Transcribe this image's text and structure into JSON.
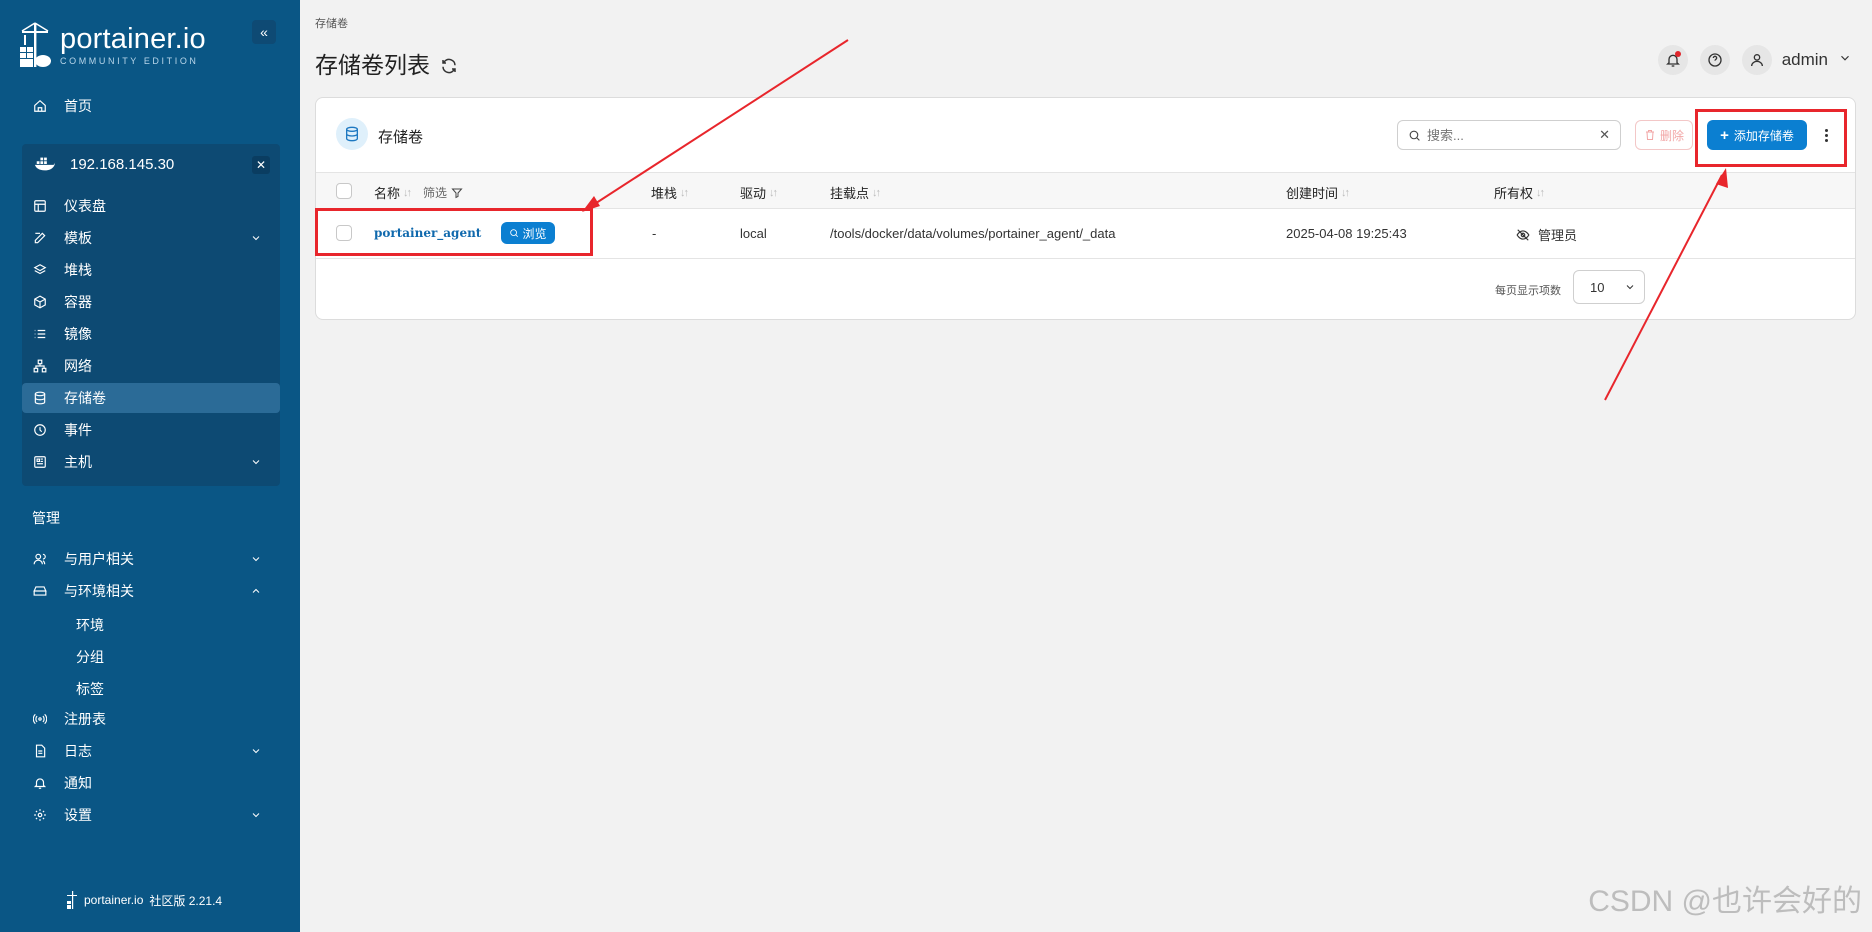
{
  "sidebar": {
    "brand": "portainer.io",
    "edition": "COMMUNITY EDITION",
    "home": "首页",
    "environment": {
      "name": "192.168.145.30",
      "items": [
        {
          "label": "仪表盘",
          "icon": "dashboard-icon"
        },
        {
          "label": "模板",
          "icon": "edit-icon",
          "expandable": true
        },
        {
          "label": "堆栈",
          "icon": "layers-icon"
        },
        {
          "label": "容器",
          "icon": "box-icon"
        },
        {
          "label": "镜像",
          "icon": "list-icon"
        },
        {
          "label": "网络",
          "icon": "network-icon"
        },
        {
          "label": "存储卷",
          "icon": "database-icon",
          "active": true
        },
        {
          "label": "事件",
          "icon": "clock-icon"
        },
        {
          "label": "主机",
          "icon": "host-icon",
          "expandable": true
        }
      ]
    },
    "admin_title": "管理",
    "admin_items": {
      "users": "与用户相关",
      "env": "与环境相关",
      "env_sub": [
        "环境",
        "分组",
        "标签"
      ],
      "registry": "注册表",
      "logs": "日志",
      "notifications": "通知",
      "settings": "设置"
    },
    "footer": {
      "brand": "portainer.io",
      "version": "社区版 2.21.4"
    }
  },
  "header": {
    "breadcrumb": "存储卷",
    "title": "存储卷列表",
    "user": "admin"
  },
  "card": {
    "title": "存储卷",
    "search_placeholder": "搜索...",
    "delete_label": "删除",
    "add_label": "添加存储卷",
    "columns": {
      "name": "名称",
      "filter": "筛选",
      "stack": "堆栈",
      "driver": "驱动",
      "mountpoint": "挂载点",
      "created": "创建时间",
      "ownership": "所有权"
    },
    "rows": [
      {
        "name": "portainer_agent",
        "browse": "浏览",
        "stack": "-",
        "driver": "local",
        "mountpoint": "/tools/docker/data/volumes/portainer_agent/_data",
        "created": "2025-04-08 19:25:43",
        "ownership": "管理员"
      }
    ],
    "per_page_label": "每页显示项数",
    "per_page_value": "10"
  },
  "watermark": "CSDN @也许会好的",
  "colors": {
    "sidebar": "#0a5685",
    "accent": "#0b7fd1",
    "annotation": "#e8262c"
  }
}
